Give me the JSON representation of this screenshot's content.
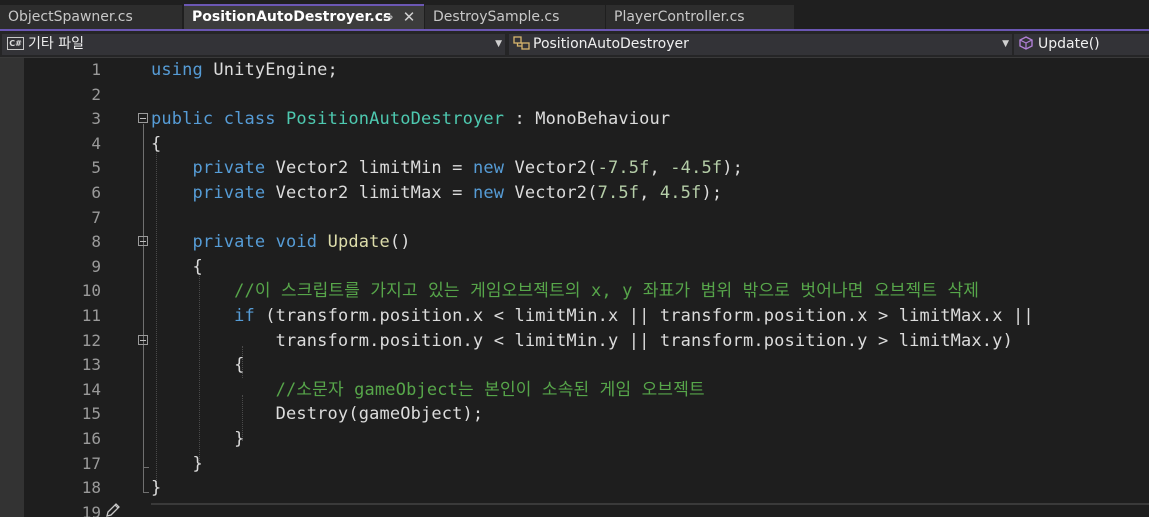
{
  "tabs": [
    {
      "label": "ObjectSpawner.cs",
      "active": false
    },
    {
      "label": "PositionAutoDestroyer.cs",
      "active": true
    },
    {
      "label": "DestroySample.cs",
      "active": false
    },
    {
      "label": "PlayerController.cs",
      "active": false
    }
  ],
  "tab_icons": {
    "pin": "⊸",
    "close": "✕"
  },
  "navbar": {
    "project": {
      "icon": "csharp-project-icon",
      "icon_text": "C#",
      "label": "기타 파일"
    },
    "type": {
      "icon": "class-icon",
      "label": "PositionAutoDestroyer"
    },
    "member": {
      "icon": "method-icon",
      "label": "Update()"
    }
  },
  "editor": {
    "lines": [
      {
        "num": "1"
      },
      {
        "num": "2"
      },
      {
        "num": "3"
      },
      {
        "num": "4"
      },
      {
        "num": "5"
      },
      {
        "num": "6"
      },
      {
        "num": "7"
      },
      {
        "num": "8"
      },
      {
        "num": "9"
      },
      {
        "num": "10"
      },
      {
        "num": "11"
      },
      {
        "num": "12"
      },
      {
        "num": "13"
      },
      {
        "num": "14"
      },
      {
        "num": "15"
      },
      {
        "num": "16"
      },
      {
        "num": "17"
      },
      {
        "num": "18"
      },
      {
        "num": "19"
      }
    ],
    "code": {
      "l1": {
        "kw": "using",
        "rest": " UnityEngine;"
      },
      "l3": {
        "kw1": "public",
        "kw2": "class",
        "cls": "PositionAutoDestroyer",
        "rest": " : MonoBehaviour"
      },
      "l4": {
        "text": "{"
      },
      "l5": {
        "kw": "private",
        "t1": " Vector2 limitMin = ",
        "kw2": "new",
        "t2": " Vector2(",
        "n1": "-7.5f",
        "t3": ", ",
        "n2": "-4.5f",
        "t4": ");"
      },
      "l6": {
        "kw": "private",
        "t1": " Vector2 limitMax = ",
        "kw2": "new",
        "t2": " Vector2(",
        "n1": "7.5f",
        "t3": ", ",
        "n2": "4.5f",
        "t4": ");"
      },
      "l8": {
        "kw1": "private",
        "kw2": "void",
        "fn": "Update",
        "rest": "()"
      },
      "l9": {
        "text": "{"
      },
      "l10": {
        "comment": "//이 스크립트를 가지고 있는 게임오브젝트의 x, y 좌표가 범위 밖으로 벗어나면 오브젝트 삭제"
      },
      "l11": {
        "kw": "if",
        "rest": " (transform.position.x < limitMin.x || transform.position.x > limitMax.x ||"
      },
      "l12": {
        "text": "transform.position.y < limitMin.y || transform.position.y > limitMax.y)"
      },
      "l13": {
        "text": "{"
      },
      "l14": {
        "comment": "//소문자 gameObject는 본인이 소속된 게임 오브젝트"
      },
      "l15": {
        "text": "Destroy(gameObject);"
      },
      "l16": {
        "text": "}"
      },
      "l17": {
        "text": "}"
      },
      "l18": {
        "text": "}"
      }
    }
  },
  "colors": {
    "background": "#1e1e1e",
    "keyword": "#569cd6",
    "type": "#4ec9b0",
    "method": "#dcdcaa",
    "number": "#b5cea8",
    "comment": "#57a64a",
    "plain": "#dcdcdc",
    "line_number": "#9a9a9a",
    "tab_accent": "#6b57b3"
  }
}
